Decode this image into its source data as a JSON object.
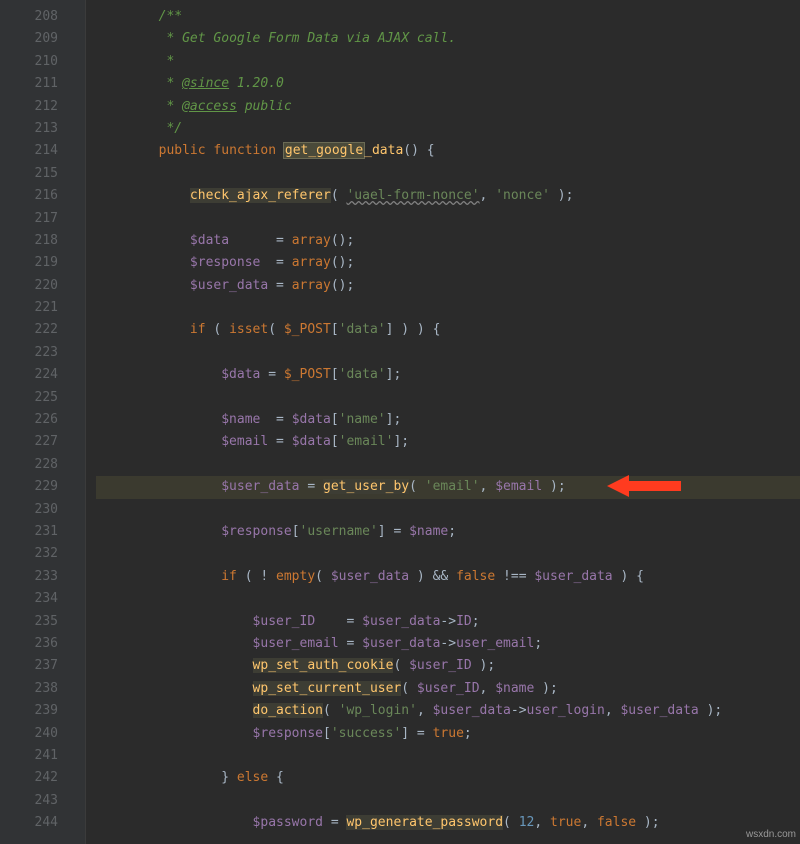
{
  "gutter": {
    "start": 208,
    "end": 244
  },
  "lines": [
    {
      "indent": 2,
      "tokens": [
        {
          "t": "comment",
          "v": "/**"
        }
      ]
    },
    {
      "indent": 2,
      "tokens": [
        {
          "t": "comment",
          "v": " * Get Google Form Data via AJAX call."
        }
      ]
    },
    {
      "indent": 2,
      "tokens": [
        {
          "t": "comment",
          "v": " *"
        }
      ]
    },
    {
      "indent": 2,
      "tokens": [
        {
          "t": "comment",
          "v": " * "
        },
        {
          "t": "doctag",
          "v": "@since"
        },
        {
          "t": "comment",
          "v": " 1.20.0"
        }
      ]
    },
    {
      "indent": 2,
      "tokens": [
        {
          "t": "comment",
          "v": " * "
        },
        {
          "t": "doctag",
          "v": "@access"
        },
        {
          "t": "comment",
          "v": " public"
        }
      ]
    },
    {
      "indent": 2,
      "tokens": [
        {
          "t": "comment",
          "v": " */"
        }
      ]
    },
    {
      "indent": 2,
      "tokens": [
        {
          "t": "keyword",
          "v": "public"
        },
        {
          "t": "plain",
          "v": " "
        },
        {
          "t": "keyword",
          "v": "function"
        },
        {
          "t": "plain",
          "v": " "
        },
        {
          "t": "func-hl",
          "v": "get_google"
        },
        {
          "t": "func",
          "v": "_data"
        },
        {
          "t": "plain",
          "v": "() {"
        }
      ]
    },
    {
      "indent": 2,
      "tokens": []
    },
    {
      "indent": 3,
      "tokens": [
        {
          "t": "func-bg",
          "v": "check_ajax_referer"
        },
        {
          "t": "plain",
          "v": "( "
        },
        {
          "t": "string-u",
          "v": "'uael-form-nonce'"
        },
        {
          "t": "plain",
          "v": ", "
        },
        {
          "t": "string",
          "v": "'nonce'"
        },
        {
          "t": "plain",
          "v": " );"
        }
      ]
    },
    {
      "indent": 3,
      "tokens": []
    },
    {
      "indent": 3,
      "tokens": [
        {
          "t": "var",
          "v": "$data"
        },
        {
          "t": "plain",
          "v": "      = "
        },
        {
          "t": "keyword",
          "v": "array"
        },
        {
          "t": "plain",
          "v": "();"
        }
      ]
    },
    {
      "indent": 3,
      "tokens": [
        {
          "t": "var",
          "v": "$response"
        },
        {
          "t": "plain",
          "v": "  = "
        },
        {
          "t": "keyword",
          "v": "array"
        },
        {
          "t": "plain",
          "v": "();"
        }
      ]
    },
    {
      "indent": 3,
      "tokens": [
        {
          "t": "var",
          "v": "$user_data"
        },
        {
          "t": "plain",
          "v": " = "
        },
        {
          "t": "keyword",
          "v": "array"
        },
        {
          "t": "plain",
          "v": "();"
        }
      ]
    },
    {
      "indent": 3,
      "tokens": []
    },
    {
      "indent": 3,
      "tokens": [
        {
          "t": "keyword",
          "v": "if"
        },
        {
          "t": "plain",
          "v": " ( "
        },
        {
          "t": "keyword",
          "v": "isset"
        },
        {
          "t": "plain",
          "v": "( "
        },
        {
          "t": "global",
          "v": "$_POST"
        },
        {
          "t": "plain",
          "v": "["
        },
        {
          "t": "string",
          "v": "'data'"
        },
        {
          "t": "plain",
          "v": "] ) ) {"
        }
      ]
    },
    {
      "indent": 3,
      "tokens": []
    },
    {
      "indent": 4,
      "tokens": [
        {
          "t": "var",
          "v": "$data"
        },
        {
          "t": "plain",
          "v": " = "
        },
        {
          "t": "global",
          "v": "$_POST"
        },
        {
          "t": "plain",
          "v": "["
        },
        {
          "t": "string",
          "v": "'data'"
        },
        {
          "t": "plain",
          "v": "];"
        }
      ]
    },
    {
      "indent": 4,
      "tokens": []
    },
    {
      "indent": 4,
      "tokens": [
        {
          "t": "var",
          "v": "$name"
        },
        {
          "t": "plain",
          "v": "  = "
        },
        {
          "t": "var",
          "v": "$data"
        },
        {
          "t": "plain",
          "v": "["
        },
        {
          "t": "string",
          "v": "'name'"
        },
        {
          "t": "plain",
          "v": "];"
        }
      ]
    },
    {
      "indent": 4,
      "tokens": [
        {
          "t": "var",
          "v": "$email"
        },
        {
          "t": "plain",
          "v": " = "
        },
        {
          "t": "var",
          "v": "$data"
        },
        {
          "t": "plain",
          "v": "["
        },
        {
          "t": "string",
          "v": "'email'"
        },
        {
          "t": "plain",
          "v": "];"
        }
      ]
    },
    {
      "indent": 4,
      "tokens": []
    },
    {
      "indent": 4,
      "hl": true,
      "tokens": [
        {
          "t": "var",
          "v": "$user_data"
        },
        {
          "t": "plain",
          "v": " = "
        },
        {
          "t": "func-bg",
          "v": "get_user_by"
        },
        {
          "t": "plain",
          "v": "( "
        },
        {
          "t": "string",
          "v": "'email'"
        },
        {
          "t": "plain",
          "v": ", "
        },
        {
          "t": "var",
          "v": "$email"
        },
        {
          "t": "plain",
          "v": " );"
        }
      ]
    },
    {
      "indent": 4,
      "tokens": []
    },
    {
      "indent": 4,
      "tokens": [
        {
          "t": "var",
          "v": "$response"
        },
        {
          "t": "plain",
          "v": "["
        },
        {
          "t": "string",
          "v": "'username'"
        },
        {
          "t": "plain",
          "v": "] = "
        },
        {
          "t": "var",
          "v": "$name"
        },
        {
          "t": "plain",
          "v": ";"
        }
      ]
    },
    {
      "indent": 4,
      "tokens": []
    },
    {
      "indent": 4,
      "tokens": [
        {
          "t": "keyword",
          "v": "if"
        },
        {
          "t": "plain",
          "v": " ( ! "
        },
        {
          "t": "keyword",
          "v": "empty"
        },
        {
          "t": "plain",
          "v": "( "
        },
        {
          "t": "var",
          "v": "$user_data"
        },
        {
          "t": "plain",
          "v": " ) && "
        },
        {
          "t": "keyword",
          "v": "false"
        },
        {
          "t": "plain",
          "v": " !== "
        },
        {
          "t": "var",
          "v": "$user_data"
        },
        {
          "t": "plain",
          "v": " ) {"
        }
      ]
    },
    {
      "indent": 4,
      "tokens": []
    },
    {
      "indent": 5,
      "tokens": [
        {
          "t": "var",
          "v": "$user_ID"
        },
        {
          "t": "plain",
          "v": "    = "
        },
        {
          "t": "var",
          "v": "$user_data"
        },
        {
          "t": "plain",
          "v": "->"
        },
        {
          "t": "const",
          "v": "ID"
        },
        {
          "t": "plain",
          "v": ";"
        }
      ]
    },
    {
      "indent": 5,
      "tokens": [
        {
          "t": "var",
          "v": "$user_email"
        },
        {
          "t": "plain",
          "v": " = "
        },
        {
          "t": "var",
          "v": "$user_data"
        },
        {
          "t": "plain",
          "v": "->"
        },
        {
          "t": "const",
          "v": "user_email"
        },
        {
          "t": "plain",
          "v": ";"
        }
      ]
    },
    {
      "indent": 5,
      "tokens": [
        {
          "t": "func-bg",
          "v": "wp_set_auth_cookie"
        },
        {
          "t": "plain",
          "v": "( "
        },
        {
          "t": "var",
          "v": "$user_ID"
        },
        {
          "t": "plain",
          "v": " );"
        }
      ]
    },
    {
      "indent": 5,
      "tokens": [
        {
          "t": "func-bg",
          "v": "wp_set_current_user"
        },
        {
          "t": "plain",
          "v": "( "
        },
        {
          "t": "var",
          "v": "$user_ID"
        },
        {
          "t": "plain",
          "v": ", "
        },
        {
          "t": "var",
          "v": "$name"
        },
        {
          "t": "plain",
          "v": " );"
        }
      ]
    },
    {
      "indent": 5,
      "tokens": [
        {
          "t": "func-bg",
          "v": "do_action"
        },
        {
          "t": "plain",
          "v": "( "
        },
        {
          "t": "string",
          "v": "'wp_login'"
        },
        {
          "t": "plain",
          "v": ", "
        },
        {
          "t": "var",
          "v": "$user_data"
        },
        {
          "t": "plain",
          "v": "->"
        },
        {
          "t": "const",
          "v": "user_login"
        },
        {
          "t": "plain",
          "v": ", "
        },
        {
          "t": "var",
          "v": "$user_data"
        },
        {
          "t": "plain",
          "v": " );"
        }
      ]
    },
    {
      "indent": 5,
      "tokens": [
        {
          "t": "var",
          "v": "$response"
        },
        {
          "t": "plain",
          "v": "["
        },
        {
          "t": "string",
          "v": "'success'"
        },
        {
          "t": "plain",
          "v": "] = "
        },
        {
          "t": "keyword",
          "v": "true"
        },
        {
          "t": "plain",
          "v": ";"
        }
      ]
    },
    {
      "indent": 5,
      "tokens": []
    },
    {
      "indent": 4,
      "tokens": [
        {
          "t": "plain",
          "v": "} "
        },
        {
          "t": "keyword",
          "v": "else"
        },
        {
          "t": "plain",
          "v": " {"
        }
      ]
    },
    {
      "indent": 4,
      "tokens": []
    },
    {
      "indent": 5,
      "tokens": [
        {
          "t": "var",
          "v": "$password"
        },
        {
          "t": "plain",
          "v": " = "
        },
        {
          "t": "func-bg",
          "v": "wp_generate_password"
        },
        {
          "t": "plain",
          "v": "( "
        },
        {
          "t": "num",
          "v": "12"
        },
        {
          "t": "plain",
          "v": ", "
        },
        {
          "t": "keyword",
          "v": "true"
        },
        {
          "t": "plain",
          "v": ", "
        },
        {
          "t": "keyword",
          "v": "false"
        },
        {
          "t": "plain",
          "v": " );"
        }
      ]
    }
  ],
  "arrow": {
    "color": "#ff3b1f"
  },
  "watermark": "wsxdn.com"
}
